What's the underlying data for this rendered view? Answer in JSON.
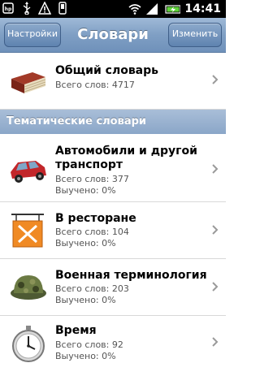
{
  "status_bar": {
    "time": "14:41",
    "icons": [
      "hp-icon",
      "usb-icon",
      "warning-icon",
      "phone-icon",
      "wifi-icon",
      "signal-icon",
      "battery-charging-icon"
    ]
  },
  "nav": {
    "left_button": "Настройки",
    "title": "Словари",
    "right_button": "Изменить"
  },
  "general": {
    "title": "Общий словарь",
    "words": "Всего слов: 4717"
  },
  "section_title": "Тематические словари",
  "items": [
    {
      "title": "Автомобили и другой транспорт",
      "words": "Всего слов: 377",
      "learned": "Выучено: 0%"
    },
    {
      "title": "В ресторане",
      "words": "Всего слов: 104",
      "learned": "Выучено: 0%"
    },
    {
      "title": "Военная терминология",
      "words": "Всего слов: 203",
      "learned": "Выучено: 0%"
    },
    {
      "title": "Время",
      "words": "Всего слов: 92",
      "learned": "Выучено: 0%"
    }
  ]
}
